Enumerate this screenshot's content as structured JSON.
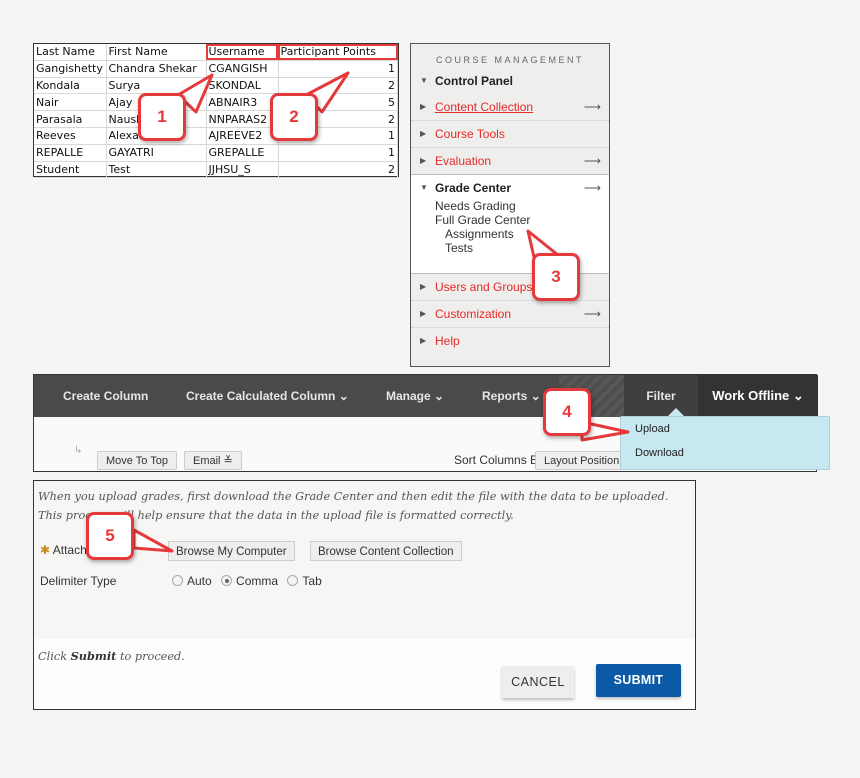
{
  "spreadsheet": {
    "headers": [
      "Last Name",
      "First Name",
      "Username",
      "Participant Points"
    ],
    "rows": [
      [
        "Gangishetty",
        "Chandra Shekar",
        "CGANGISH",
        "1"
      ],
      [
        "Kondala",
        "Surya",
        "SKONDAL",
        "2"
      ],
      [
        "Nair",
        "Ajay",
        "ABNAIR3",
        "5"
      ],
      [
        "Parasala",
        "Naushil",
        "NNPARAS2",
        "2"
      ],
      [
        "Reeves",
        "Alexander",
        "AJREEVE2",
        "1"
      ],
      [
        "REPALLE",
        "GAYATRI",
        "GREPALLE",
        "1"
      ],
      [
        "Student",
        "Test",
        "JJHSU_S",
        "2"
      ]
    ]
  },
  "course_management": {
    "title": "COURSE MANAGEMENT",
    "control_panel": "Control Panel",
    "items_top": [
      {
        "label": "Content Collection",
        "arrow": true
      },
      {
        "label": "Course Tools",
        "arrow": false
      },
      {
        "label": "Evaluation",
        "arrow": true
      }
    ],
    "grade_center": {
      "label": "Grade Center",
      "sub": [
        "Needs Grading",
        "Full Grade Center"
      ],
      "sub_indented": [
        "Assignments",
        "Tests"
      ]
    },
    "items_bottom": [
      {
        "label": "Users and Groups",
        "arrow": false
      },
      {
        "label": "Customization",
        "arrow": true
      },
      {
        "label": "Help",
        "arrow": false
      }
    ],
    "arrow_glyph": "⟶",
    "tri_open": "▼",
    "tri_closed": "▶"
  },
  "toolbar": {
    "items": [
      "Create Column",
      "Create Calculated Column ⌄",
      "Manage ⌄",
      "Reports ⌄"
    ],
    "filter": "Filter",
    "work_offline": "Work Offline ⌄",
    "move_to_top": "Move To Top",
    "email": "Email ≚",
    "sort_label": "Sort Columns By:",
    "sort_value": "Layout Position",
    "dropdown": [
      "Upload",
      "Download"
    ]
  },
  "upload_form": {
    "intro_line1": "When you upload grades, first download the Grade Center and then edit the file with the data to be uploaded.",
    "intro_line2": "This process will help ensure that the data in the upload file is formatted correctly.",
    "required_mark": "✱",
    "attach_label": "Attach File",
    "browse_computer": "Browse My Computer",
    "browse_collection": "Browse Content Collection",
    "delimiter_label": "Delimiter Type",
    "delimiter_options": [
      "Auto",
      "Comma",
      "Tab"
    ],
    "delimiter_selected": "Comma",
    "note_pre": "Click ",
    "note_bold": "Submit",
    "note_post": " to proceed.",
    "cancel": "CANCEL",
    "submit": "SUBMIT"
  },
  "callouts": [
    "1",
    "2",
    "3",
    "4",
    "5"
  ],
  "colors": {
    "callout_red": "#e5393c",
    "link_red": "#e32b2b",
    "submit_blue": "#0b5aa8",
    "toolbar_dark": "#4a4a4a",
    "dropdown_bg": "#c7e8f0"
  }
}
